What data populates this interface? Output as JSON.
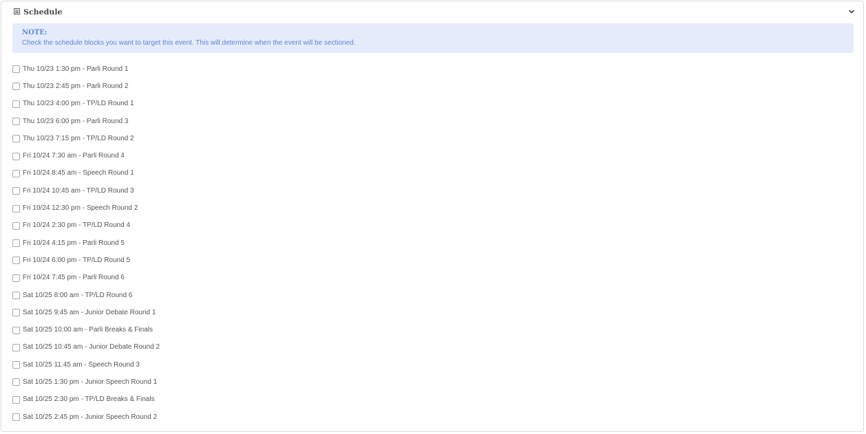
{
  "panel": {
    "title": "Schedule",
    "title_icon": "list-icon",
    "toggle_icon": "chevron-down-icon"
  },
  "note": {
    "title": "NOTE:",
    "text": "Check the schedule blocks you want to target this event. This will determine when the event will be sectioned."
  },
  "schedule_blocks": [
    {
      "label": "Thu 10/23 1:30 pm - Parli Round 1",
      "checked": false
    },
    {
      "label": "Thu 10/23 2:45 pm - Parli Round 2",
      "checked": false
    },
    {
      "label": "Thu 10/23 4:00 pm - TP/LD Round 1",
      "checked": false
    },
    {
      "label": "Thu 10/23 6:00 pm - Parli Round 3",
      "checked": false
    },
    {
      "label": "Thu 10/23 7:15 pm - TP/LD Round 2",
      "checked": false
    },
    {
      "label": "Fri 10/24 7:30 am - Parli Round 4",
      "checked": false
    },
    {
      "label": "Fri 10/24 8:45 am - Speech Round 1",
      "checked": false
    },
    {
      "label": "Fri 10/24 10:45 am - TP/LD Round 3",
      "checked": false
    },
    {
      "label": "Fri 10/24 12:30 pm - Speech Round 2",
      "checked": false
    },
    {
      "label": "Fri 10/24 2:30 pm - TP/LD Round 4",
      "checked": false
    },
    {
      "label": "Fri 10/24 4:15 pm - Parli Round 5",
      "checked": false
    },
    {
      "label": "Fri 10/24 6:00 pm - TP/LD Round 5",
      "checked": false
    },
    {
      "label": "Fri 10/24 7:45 pm - Parli Round 6",
      "checked": false
    },
    {
      "label": "Sat 10/25 8:00 am - TP/LD Round 6",
      "checked": false
    },
    {
      "label": "Sat 10/25 9:45 am - Junior Debate Round 1",
      "checked": false
    },
    {
      "label": "Sat 10/25 10:00 am - Parli Breaks & Finals",
      "checked": false
    },
    {
      "label": "Sat 10/25 10:45 am - Junior Debate Round 2",
      "checked": false
    },
    {
      "label": "Sat 10/25 11:45 am - Speech Round 3",
      "checked": false
    },
    {
      "label": "Sat 10/25 1:30 pm - Junior Speech Round 1",
      "checked": false
    },
    {
      "label": "Sat 10/25 2:30 pm - TP/LD Breaks & Finals",
      "checked": false
    },
    {
      "label": "Sat 10/25 2:45 pm - Junior Speech Round 2",
      "checked": false
    }
  ]
}
